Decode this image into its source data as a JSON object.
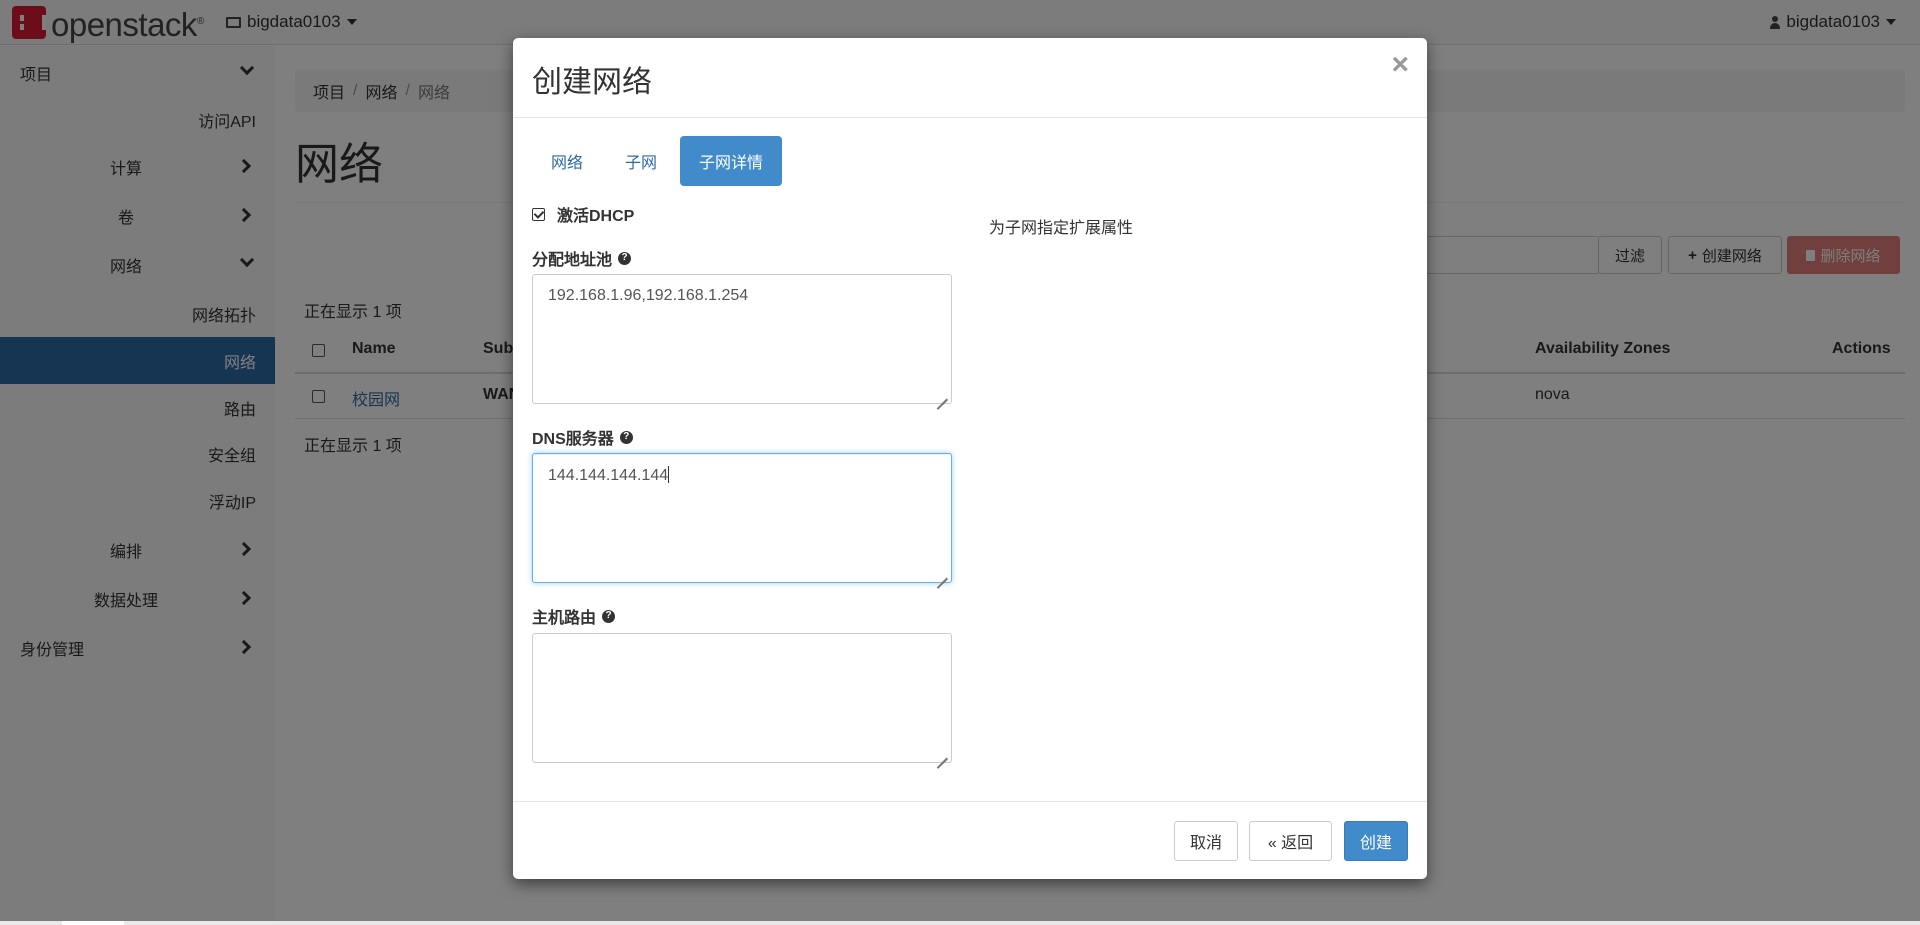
{
  "navbar": {
    "brand": "openstack",
    "brand_mark": "®",
    "project": "bigdata0103",
    "user": "bigdata0103"
  },
  "sidebar": {
    "project": "项目",
    "access_api": "访问API",
    "compute": "计算",
    "volumes": "卷",
    "network": "网络",
    "network_topology": "网络拓扑",
    "networks": "网络",
    "routers": "路由",
    "security_groups": "安全组",
    "floating_ips": "浮动IP",
    "orchestration": "编排",
    "data_processing": "数据处理",
    "identity": "身份管理"
  },
  "main": {
    "breadcrumb": [
      "项目",
      "网络",
      "网络"
    ],
    "title": "网络",
    "filter_button": "过滤",
    "create_button": "创建网络",
    "delete_button": "删除网络",
    "count_top": "正在显示 1 项",
    "count_bottom": "正在显示 1 项",
    "table": {
      "headers": [
        "Name",
        "Sub",
        "Availability Zones",
        "Actions"
      ],
      "rows": [
        {
          "name": "校园网",
          "subnet": "WAN",
          "az": "nova"
        }
      ]
    }
  },
  "modal": {
    "title": "创建网络",
    "close": "×",
    "tabs": [
      "网络",
      "子网",
      "子网详情"
    ],
    "active_tab": "子网详情",
    "enable_dhcp": {
      "label": "激活DHCP",
      "checked": true
    },
    "allocation_pools": {
      "label": "分配地址池",
      "value": "192.168.1.96,192.168.1.254"
    },
    "dns": {
      "label": "DNS服务器",
      "value": "144.144.144.144"
    },
    "host_routes": {
      "label": "主机路由",
      "value": ""
    },
    "help_text": "为子网指定扩展属性",
    "buttons": {
      "cancel": "取消",
      "back": "« 返回",
      "create": "创建"
    }
  },
  "colors": {
    "primary": "#428bca",
    "sidebar_active": "#2c6ba4",
    "danger": "#d9534f",
    "brand": "#da1a32"
  }
}
